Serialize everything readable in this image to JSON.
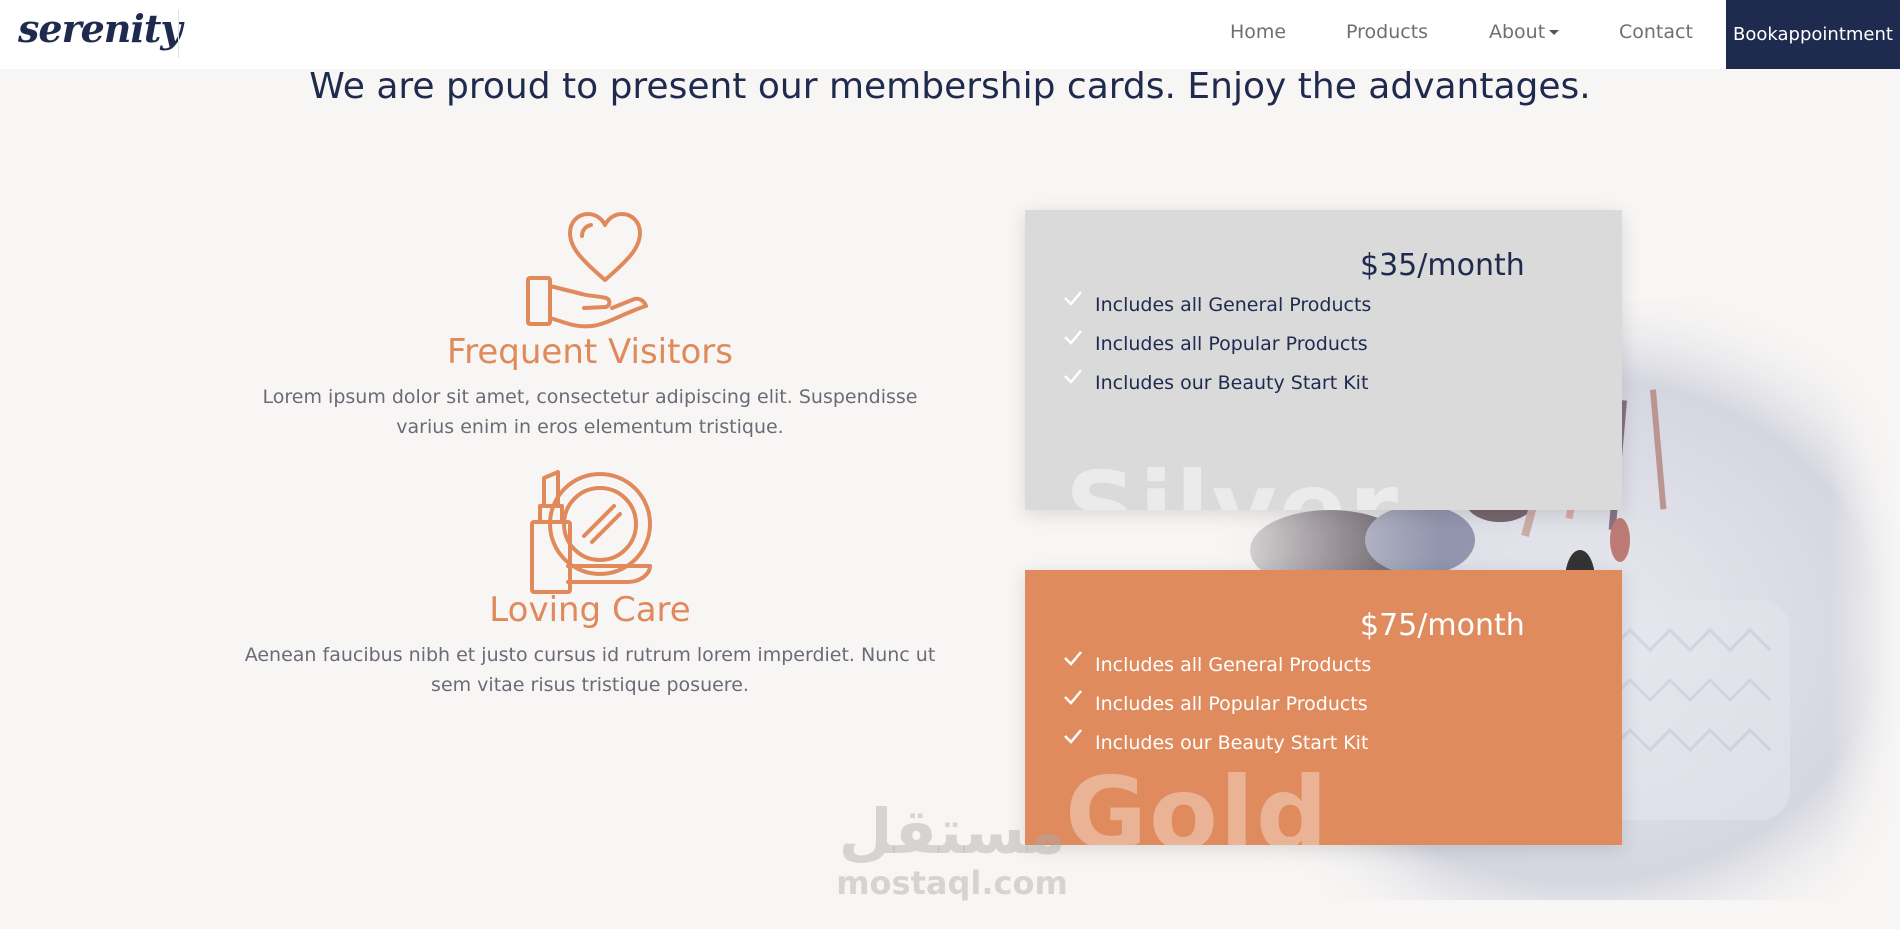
{
  "nav": {
    "logo": "serenity",
    "items": [
      {
        "label": "Home"
      },
      {
        "label": "Products"
      },
      {
        "label": "About"
      },
      {
        "label": "Contact"
      }
    ],
    "cta": "Bookappointment"
  },
  "headline": "We are proud to present our membership cards. Enjoy the advantages.",
  "features": [
    {
      "icon": "heart-hand-icon",
      "title": "Frequent Visitors",
      "text_line1": "Lorem ipsum dolor sit amet, consectetur adipiscing elit. Suspendisse",
      "text_line2": "varius enim in eros elementum tristique."
    },
    {
      "icon": "lipstick-mirror-icon",
      "title": "Loving Care",
      "text_line1": "Aenean faucibus nibh et justo cursus id rutrum lorem imperdiet. Nunc ut",
      "text_line2": "sem vitae risus tristique posuere."
    }
  ],
  "plans": [
    {
      "name": "Silver",
      "price": "$35/month",
      "perks": [
        "Includes all General Products",
        "Includes all Popular Products",
        "Includes our Beauty Start Kit"
      ]
    },
    {
      "name": "Gold",
      "price": "$75/month",
      "perks": [
        "Includes all General Products",
        "Includes all Popular Products",
        "Includes our Beauty Start Kit"
      ]
    }
  ],
  "watermark": {
    "arabic": "مستقل",
    "latin": "mostaql.com"
  },
  "colors": {
    "navy": "#1f2a4f",
    "accent": "#e08a5b",
    "silver": "#dadada",
    "gold": "#df8b5e"
  }
}
